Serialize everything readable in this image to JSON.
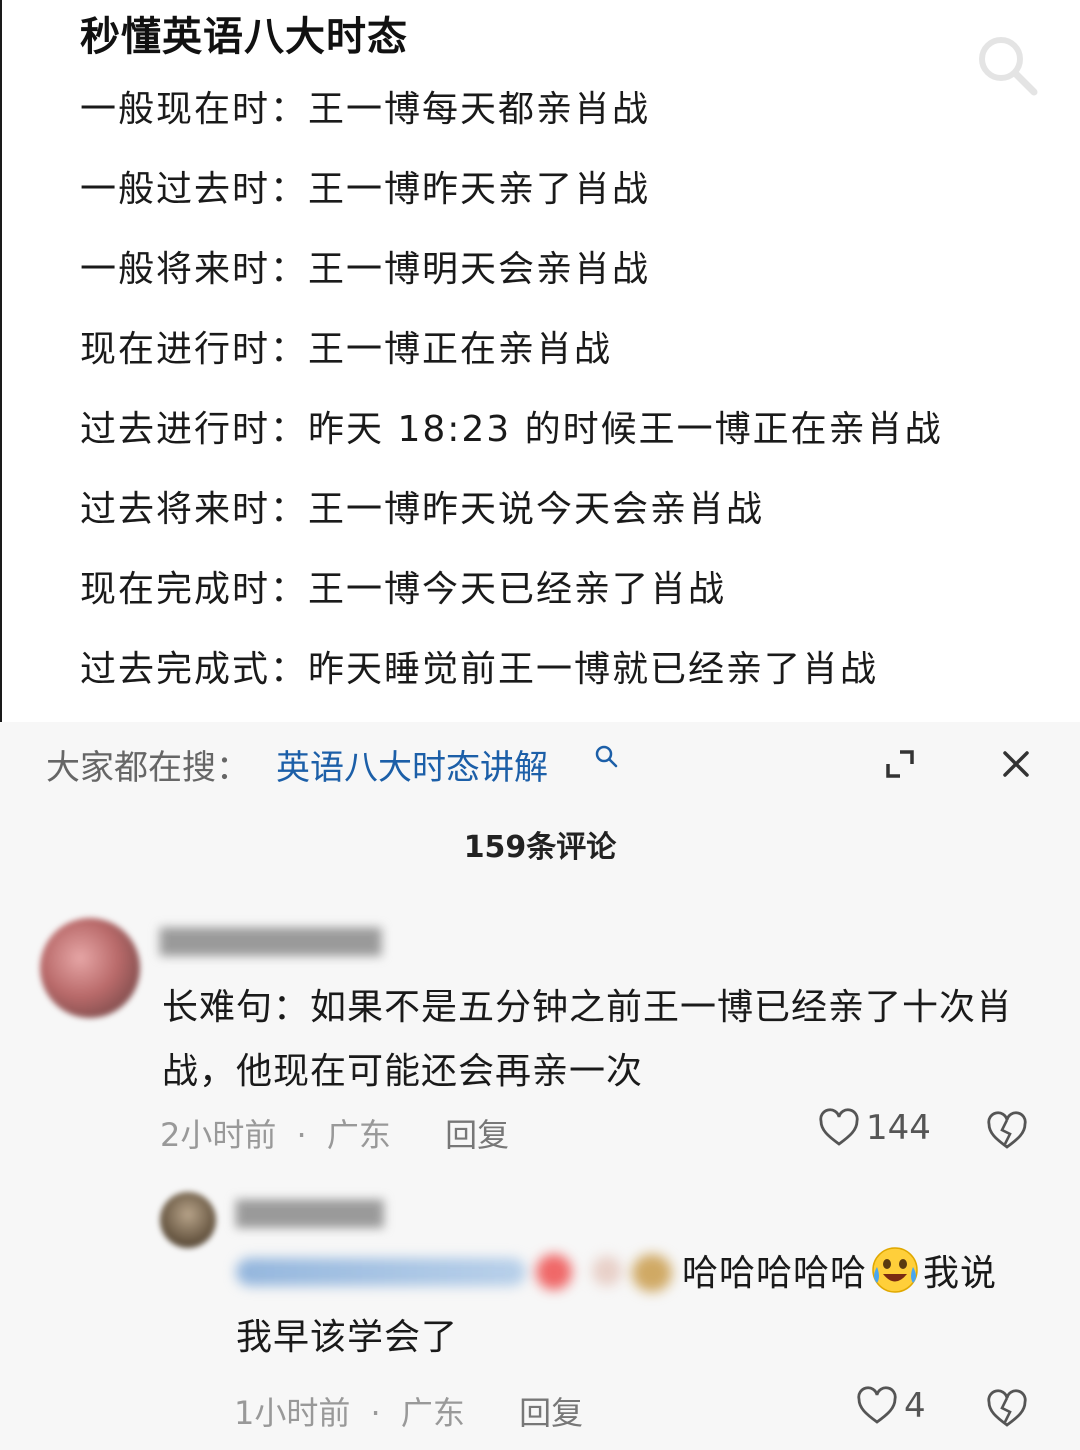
{
  "note": {
    "title": "秒懂英语八大时态",
    "tenses": [
      "一般现在时：王一博每天都亲肖战",
      "一般过去时：王一博昨天亲了肖战",
      "一般将来时：王一博明天会亲肖战",
      "现在进行时：王一博正在亲肖战",
      "过去进行时：昨天 18:23 的时候王一博正在亲肖战",
      "过去将来时：王一博昨天说今天会亲肖战",
      "现在完成时：王一博今天已经亲了肖战",
      "过去完成式：昨天睡觉前王一博就已经亲了肖战"
    ]
  },
  "search": {
    "prefix": "大家都在搜：",
    "query": "英语八大时态讲解",
    "icons": {
      "query": "search-icon",
      "expand": "expand-icon",
      "close": "close-icon"
    }
  },
  "comments": {
    "count_label": "159条评论",
    "items": [
      {
        "text": "长难句：如果不是五分钟之前王一博已经亲了十次肖战，他现在可能还会再亲一次",
        "time": "2小时前",
        "location": "广东",
        "reply_label": "回复",
        "likes": "144"
      }
    ],
    "replies": [
      {
        "text_tail": "哈哈哈哈哈",
        "text_end": "我说",
        "text_line2": "我早该学会了",
        "time": "1小时前",
        "location": "广东",
        "reply_label": "回复",
        "likes": "4"
      }
    ],
    "separator": "·",
    "accent_color": "#1c5fa8"
  }
}
